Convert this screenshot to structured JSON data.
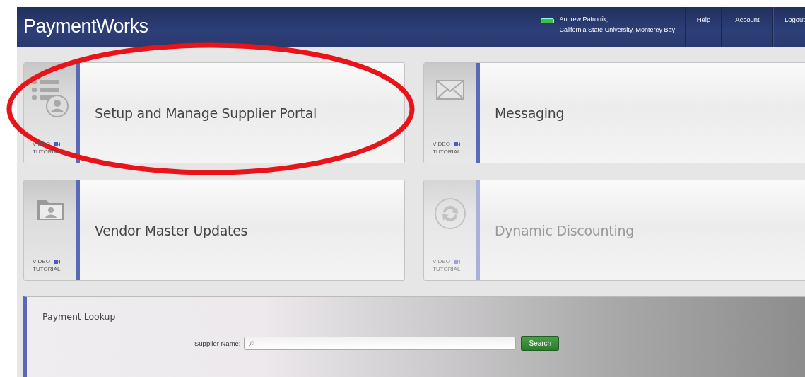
{
  "header": {
    "logo": "PaymentWorks",
    "user": {
      "name": "Andrew Patronik,",
      "organization": "California State University, Monterey Bay"
    },
    "nav": [
      "Help",
      "Account",
      "Logout"
    ]
  },
  "tiles": [
    {
      "kind": "list",
      "title": "Setup and Manage Supplier Portal",
      "video_label": [
        "VIDEO",
        "TUTORIAL"
      ],
      "disabled": false
    },
    {
      "kind": "mail",
      "title": "Messaging",
      "video_label": [
        "VIDEO",
        "TUTORIAL"
      ],
      "disabled": false
    },
    {
      "kind": "folder",
      "title": "Vendor Master Updates",
      "video_label": [
        "VIDEO",
        "TUTORIAL"
      ],
      "disabled": false
    },
    {
      "kind": "refresh",
      "title": "Dynamic Discounting",
      "video_label": [
        "VIDEO",
        "TUTORIAL"
      ],
      "disabled": true
    }
  ],
  "payment_lookup": {
    "title": "Payment Lookup",
    "field_label": "Supplier Name:",
    "button": "Search"
  },
  "annotation": {
    "kind": "ellipse"
  }
}
